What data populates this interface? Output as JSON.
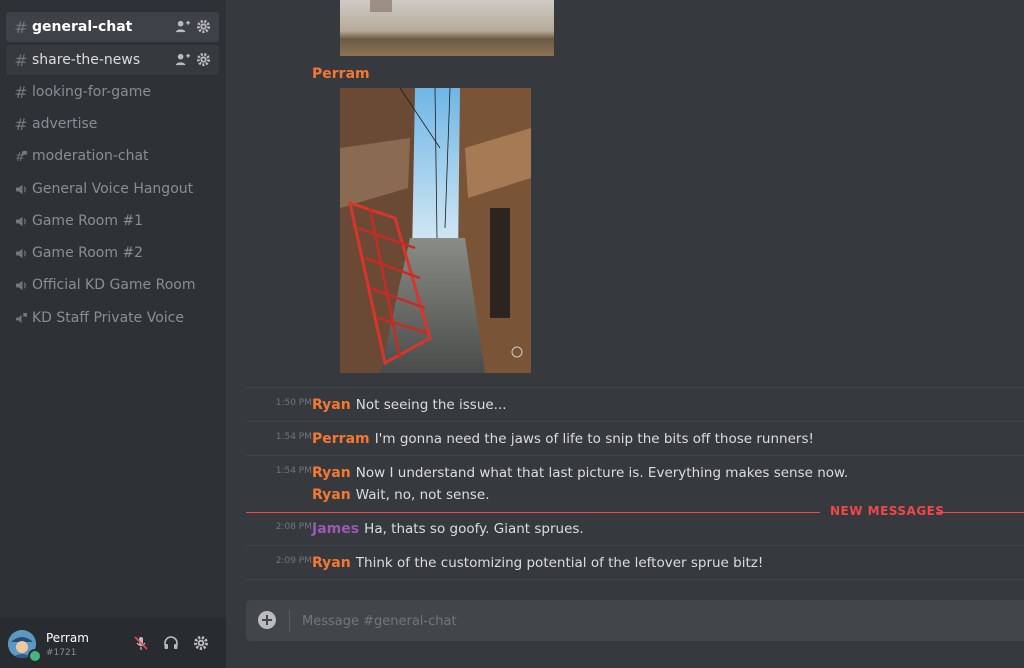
{
  "channels": [
    {
      "name": "general-chat",
      "type": "text",
      "state": "active"
    },
    {
      "name": "share-the-news",
      "type": "text",
      "state": "unread"
    },
    {
      "name": "looking-for-game",
      "type": "text",
      "state": "normal"
    },
    {
      "name": "advertise",
      "type": "text",
      "state": "normal"
    },
    {
      "name": "moderation-chat",
      "type": "text-locked",
      "state": "normal"
    },
    {
      "name": "General Voice Hangout",
      "type": "voice",
      "state": "normal"
    },
    {
      "name": "Game Room #1",
      "type": "voice",
      "state": "normal"
    },
    {
      "name": "Game Room #2",
      "type": "voice",
      "state": "normal"
    },
    {
      "name": "Official KD Game Room",
      "type": "voice",
      "state": "normal"
    },
    {
      "name": "KD Staff Private Voice",
      "type": "voice-locked",
      "state": "normal"
    }
  ],
  "user": {
    "name": "Perram",
    "discriminator": "#1721",
    "status_color": "#43b581"
  },
  "messages": {
    "image_author": "Perram",
    "groups": [
      {
        "time": "1:50 PM",
        "author": "Ryan",
        "color": "#f57731",
        "lines": [
          "Not seeing the issue..."
        ]
      },
      {
        "time": "1:54 PM",
        "author": "Perram",
        "color": "#f57731",
        "lines": [
          "I'm gonna need the jaws of life to snip the bits off those runners!"
        ]
      },
      {
        "time": "1:54 PM",
        "author": "Ryan",
        "color": "#f57731",
        "lines": [
          "Now I understand what that last picture is. Everything makes sense now.",
          "Wait, no, not sense."
        ]
      },
      {
        "time": "2:08 PM",
        "author": "James",
        "color": "#9b59b6",
        "lines": [
          "Ha, thats so goofy. Giant sprues."
        ]
      },
      {
        "time": "2:09 PM",
        "author": "Ryan",
        "color": "#f57731",
        "lines": [
          "Think of the customizing potential of the leftover sprue bitz!"
        ]
      }
    ]
  },
  "new_messages_label": "NEW MESSAGES",
  "composer": {
    "placeholder": "Message #general-chat"
  },
  "colors": {
    "accent_orange": "#f57731",
    "new_messages_red": "#f04747",
    "online_green": "#43b581"
  }
}
